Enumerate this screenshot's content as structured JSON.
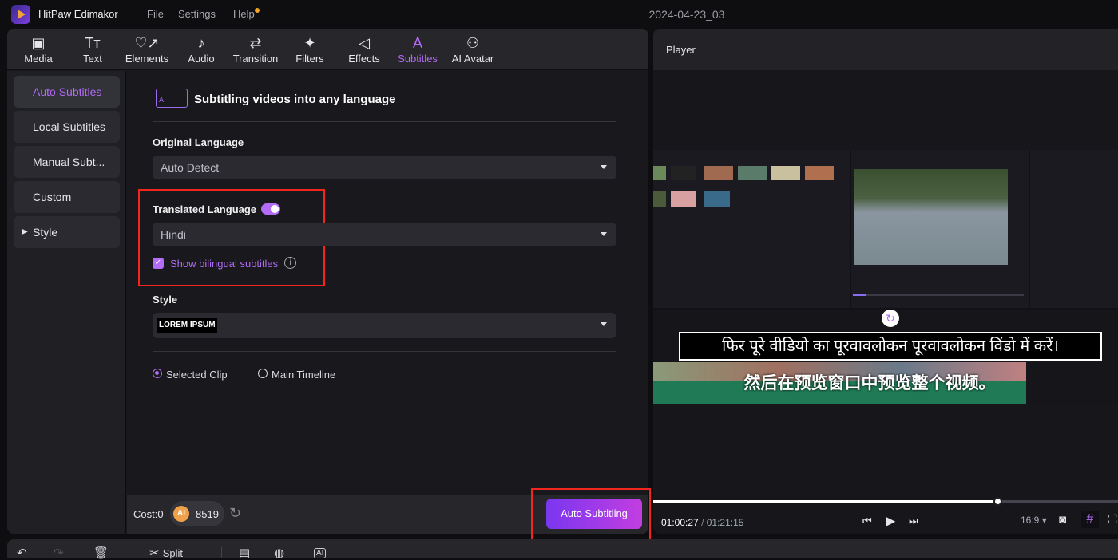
{
  "app": {
    "name": "HitPaw Edimakor",
    "menu": [
      "File",
      "Settings",
      "Help"
    ],
    "document_title": "2024-04-23_03",
    "accent": "#b36cf5"
  },
  "tabs": [
    {
      "label": "Media",
      "icon": "media-icon"
    },
    {
      "label": "Text",
      "icon": "text-icon"
    },
    {
      "label": "Elements",
      "icon": "elements-icon"
    },
    {
      "label": "Audio",
      "icon": "audio-icon"
    },
    {
      "label": "Transition",
      "icon": "transition-icon"
    },
    {
      "label": "Filters",
      "icon": "filters-icon"
    },
    {
      "label": "Effects",
      "icon": "effects-icon"
    },
    {
      "label": "Subtitles",
      "icon": "subtitles-icon",
      "active": true
    },
    {
      "label": "AI Avatar",
      "icon": "ai-avatar-icon"
    }
  ],
  "sidebar": {
    "items": [
      "Auto Subtitles",
      "Local Subtitles",
      "Manual Subt...",
      "Custom",
      "Style"
    ]
  },
  "panel": {
    "heading": "Subtitling videos into any language",
    "original_language_label": "Original Language",
    "original_language_value": "Auto Detect",
    "translated_language_label": "Translated Language",
    "translated_toggle_on": true,
    "translated_language_value": "Hindi",
    "bilingual_label": "Show bilingual subtitles",
    "bilingual_checked": true,
    "style_label": "Style",
    "style_value": "LOREM IPSUM",
    "scope_options": [
      "Selected Clip",
      "Main Timeline"
    ],
    "scope_selected": "Selected Clip"
  },
  "cost": {
    "label": "Cost:0",
    "badge": "AI",
    "credits": "8519"
  },
  "auto_button": "Auto Subtitling",
  "player": {
    "title": "Player",
    "subtitle_hindi": "फिर पूरे वीडियो का पूरवावलोकन पूरवावलोकन विंडो में करें।",
    "subtitle_chinese": "然后在预览窗口中预览整个视频。",
    "current_time": "01:00:27",
    "separator": "/",
    "total_time": "01:21:15",
    "progress": 0.74,
    "aspect": "16:9"
  },
  "toolbar": {
    "split": "Split"
  }
}
